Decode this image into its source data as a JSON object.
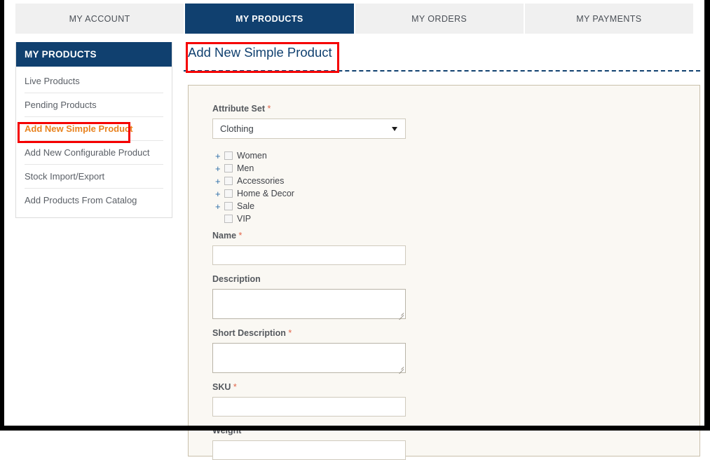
{
  "frame": {
    "note": "black browser/viewport border"
  },
  "tabs": [
    {
      "label": "MY ACCOUNT",
      "active": false
    },
    {
      "label": "MY PRODUCTS",
      "active": true
    },
    {
      "label": "MY ORDERS",
      "active": false
    },
    {
      "label": "MY PAYMENTS",
      "active": false
    }
  ],
  "sidebar": {
    "header": "MY PRODUCTS",
    "items": [
      {
        "label": "Live Products",
        "active": false
      },
      {
        "label": "Pending Products",
        "active": false
      },
      {
        "label": "Add New Simple Product",
        "active": true
      },
      {
        "label": "Add New Configurable Product",
        "active": false
      },
      {
        "label": "Stock Import/Export",
        "active": false
      },
      {
        "label": "Add Products From Catalog",
        "active": false
      }
    ]
  },
  "main": {
    "page_title": "Add New Simple Product"
  },
  "form": {
    "attribute_set": {
      "label": "Attribute Set",
      "required_mark": "*",
      "value": "Clothing",
      "arrow_icon": "chevron-down-icon"
    },
    "categories": [
      {
        "label": "Women",
        "expander": "+",
        "checked": false
      },
      {
        "label": "Men",
        "expander": "+",
        "checked": false
      },
      {
        "label": "Accessories",
        "expander": "+",
        "checked": false
      },
      {
        "label": "Home & Decor",
        "expander": "+",
        "checked": false
      },
      {
        "label": "Sale",
        "expander": "+",
        "checked": false
      },
      {
        "label": "VIP",
        "expander": "",
        "checked": false
      }
    ],
    "name": {
      "label": "Name",
      "required_mark": "*",
      "value": "",
      "placeholder": ""
    },
    "description": {
      "label": "Description",
      "required_mark": "",
      "value": "",
      "placeholder": ""
    },
    "short_description": {
      "label": "Short Description",
      "required_mark": "*",
      "value": "",
      "placeholder": ""
    },
    "sku": {
      "label": "SKU",
      "required_mark": "*",
      "value": "",
      "placeholder": ""
    },
    "weight": {
      "label": "Weight",
      "required_mark": "*",
      "value": "",
      "placeholder": ""
    }
  },
  "annotations": {
    "title_box_color": "#f50000",
    "sidebar_box_color": "#f50000"
  },
  "colors": {
    "navy": "#10406f",
    "orange_active": "#e8821e",
    "required_asterisk": "#e2654a",
    "panel_bg": "#faf8f3",
    "panel_border": "#c9c0ab",
    "tab_inactive_bg": "#f0f0f0"
  }
}
